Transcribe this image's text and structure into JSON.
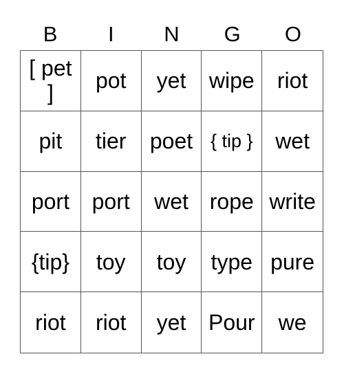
{
  "header": [
    "B",
    "I",
    "N",
    "G",
    "O"
  ],
  "cells": [
    [
      "[ pet ]",
      "pot",
      "yet",
      "wipe",
      "riot"
    ],
    [
      "pit",
      "tier",
      "poet",
      "{ tip }",
      "wet"
    ],
    [
      "port",
      "port",
      "wet",
      "rope",
      "write"
    ],
    [
      "{tip}",
      "toy",
      "toy",
      "type",
      "pure"
    ],
    [
      "riot",
      "riot",
      "yet",
      "Pour",
      "we"
    ]
  ]
}
